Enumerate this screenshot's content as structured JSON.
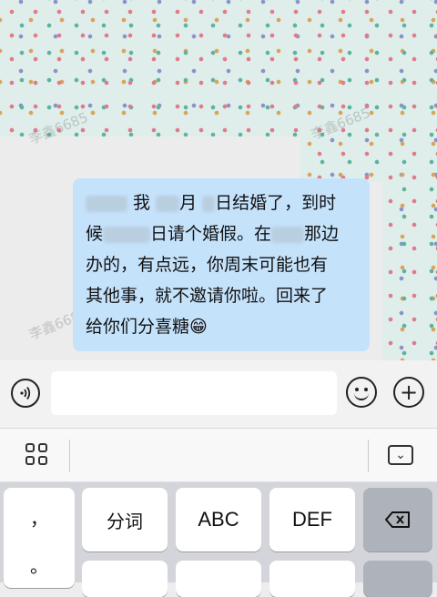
{
  "watermarks": [
    "李鑫6685",
    "李鑫6685",
    "李鑫6685"
  ],
  "message": {
    "line1": "我",
    "line1b": "月",
    "line1c": "日结婚了，到时",
    "line2a": "候",
    "line2b": "日请个婚假。在",
    "line2c": "那边",
    "line3": "办的，有点远，你周末可能也有",
    "line4": "其他事，就不邀请你啦。回来了",
    "line5": "给你们分喜糖",
    "emoji": "😁"
  },
  "input": {
    "placeholder": ""
  },
  "toolbar": {
    "plus": "+"
  },
  "keyboard": {
    "punct": [
      "，",
      "。"
    ],
    "row1": [
      "分词",
      "ABC",
      "DEF"
    ]
  },
  "colors": {
    "bubble": "#c5e2fb",
    "keyboard_bg": "#d3d5db"
  }
}
